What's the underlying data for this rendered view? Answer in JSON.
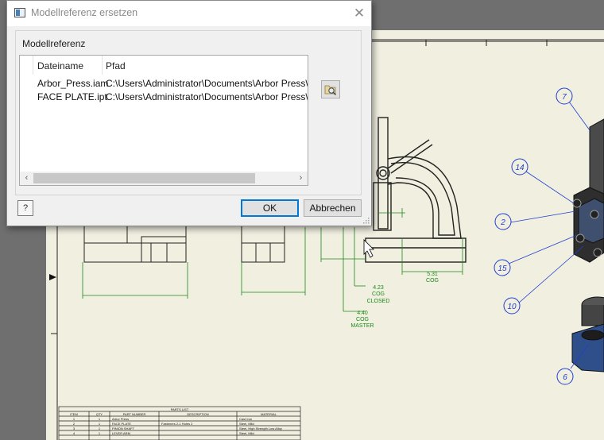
{
  "dialog": {
    "title": "Modellreferenz ersetzen",
    "close_glyph": "✕",
    "group_label": "Modellreferenz",
    "columns": {
      "name": "Dateiname",
      "path": "Pfad"
    },
    "rows": [
      {
        "name": "Arbor_Press.iam",
        "path": "C:\\Users\\Administrator\\Documents\\Arbor Press\\Arbor Press.iam"
      },
      {
        "name": "FACE PLATE.ipt",
        "path": "C:\\Users\\Administrator\\Documents\\Arbor Press\\Components\\FACE PLATE.ipt"
      }
    ],
    "scroll_left": "‹",
    "scroll_right": "›",
    "help_glyph": "?",
    "ok_label": "OK",
    "cancel_label": "Abbrechen"
  },
  "drawing": {
    "balloons": [
      "7",
      "14",
      "2",
      "15",
      "10",
      "6"
    ],
    "dimensions": [
      {
        "value": "4.23",
        "l2": "COG",
        "l3": "CLOSED"
      },
      {
        "value": "4.40",
        "l2": "COG",
        "l3": "MASTER"
      },
      {
        "value": "5.31",
        "l2": "COG",
        "l3": ""
      }
    ],
    "parts_list": {
      "title": "PARTS LIST",
      "headers": [
        "ITEM",
        "QTY",
        "PART NUMBER",
        "DESCRIPTION",
        "MATERIAL"
      ],
      "rows": [
        [
          "1",
          "1",
          "Arbor Press",
          "",
          "Cast Iron"
        ],
        [
          "2",
          "1",
          "FACE PLATE",
          "Fasteners 2-1 Holes 2",
          "Steel, Mild"
        ],
        [
          "3",
          "1",
          "PINION SHAFT",
          "",
          "Steel, High Strength Low Alloy"
        ],
        [
          "4",
          "1",
          "LEVER ARM",
          "",
          "Steel, Mild"
        ]
      ]
    },
    "colors": {
      "annotation": "#1a8a1a",
      "balloon": "#1f3fd0",
      "paper": "#f1efe0"
    }
  }
}
